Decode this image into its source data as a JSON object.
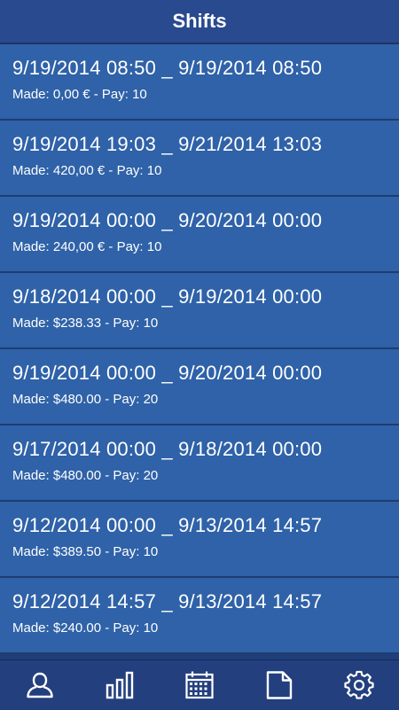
{
  "header": {
    "title": "Shifts"
  },
  "shifts": [
    {
      "range": "9/19/2014 08:50 _ 9/19/2014 08:50",
      "made": "Made: 0,00 € - Pay: 10"
    },
    {
      "range": "9/19/2014 19:03 _ 9/21/2014 13:03",
      "made": "Made: 420,00 € - Pay: 10"
    },
    {
      "range": "9/19/2014 00:00 _ 9/20/2014 00:00",
      "made": "Made: 240,00 € - Pay: 10"
    },
    {
      "range": "9/18/2014 00:00 _ 9/19/2014 00:00",
      "made": "Made: $238.33 - Pay: 10"
    },
    {
      "range": "9/19/2014 00:00 _ 9/20/2014 00:00",
      "made": "Made: $480.00 - Pay: 20"
    },
    {
      "range": "9/17/2014 00:00 _ 9/18/2014 00:00",
      "made": "Made: $480.00 - Pay: 20"
    },
    {
      "range": "9/12/2014 00:00 _ 9/13/2014 14:57",
      "made": "Made: $389.50 - Pay: 10"
    },
    {
      "range": "9/12/2014 14:57 _ 9/13/2014 14:57",
      "made": "Made: $240.00 - Pay: 10"
    }
  ],
  "tabbar": {
    "items": [
      {
        "icon": "person-icon"
      },
      {
        "icon": "bar-chart-icon"
      },
      {
        "icon": "calendar-icon"
      },
      {
        "icon": "document-icon"
      },
      {
        "icon": "gear-icon"
      }
    ]
  },
  "colors": {
    "header_bg": "#2a4a8f",
    "row_bg": "#2f62a8",
    "tabbar_bg": "#233f7e",
    "text": "#ffffff"
  }
}
